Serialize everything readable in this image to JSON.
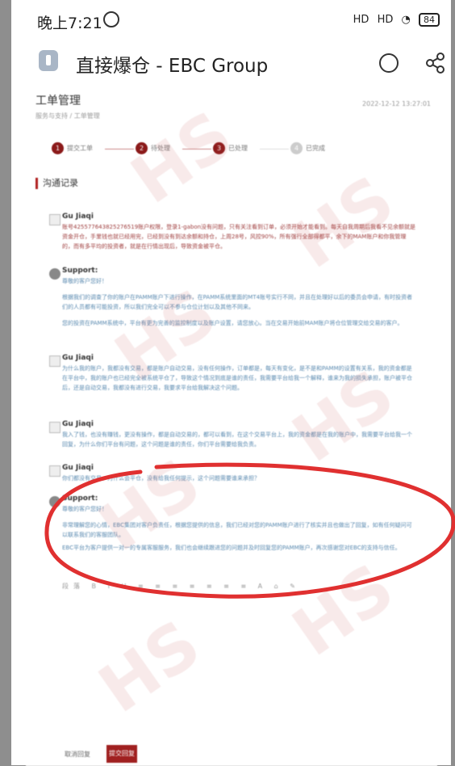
{
  "status_bar": {
    "time": "晚上7:21",
    "signal1": "HD",
    "signal2": "HD",
    "battery": "84"
  },
  "app_bar": {
    "title": "直接爆仓 - EBC Group"
  },
  "page": {
    "title": "工单管理",
    "breadcrumb": "服务与支持 / 工单管理",
    "meta": "2022-12-12 13:27:01"
  },
  "steps": [
    {
      "num": "1",
      "label": "提交工单"
    },
    {
      "num": "2",
      "label": "待处理"
    },
    {
      "num": "3",
      "label": "已处理"
    },
    {
      "num": "4",
      "label": "已完成"
    }
  ],
  "section_title": "沟通记录",
  "messages": [
    {
      "who": "Gu Jiaqi",
      "text": "账号425577643825276519账户权限，登录1-gabon没有问题，只有关注看到订单，必须开始才能看到。每天自我周期后我看不见余额就是资金开仓，手里钱也就已经用完，已经到没有到达余额和持仓，上周28号，风控90%，所有强行全部得都平，余下的MAM账户和你我管理的，而有多平均的投资者，就是在行情出现后，导致资金被平仓。"
    },
    {
      "who": "Support:",
      "text": "尊敬的客户您好！",
      "text2": "根据我们的调查了你的账户在PAMM账户下进行操作，在PAMM系统里面的MT4账号实行不同，并且在处理好以后的委员会申请，有时投资者们的人员都有可能投资，所以我们完全可以不参与仓位计划以及其他不同来。",
      "text3": "您的投资在PAMM系统中，平台有更为完善的监控制度以及账户设置，请您放心。当在交易开始前MAM账户将仓位管理交给交易的客户。"
    },
    {
      "who": "Gu Jiaqi",
      "text": "为什么我的账户，我都没有交易，都是账户自动交易，没有任何操作，订单都是，每天有变化，是不是和PAMM的设置有关系，我的资金都是在平台中，我的账户也已经完全被系统平仓了，导致这个情况到底是谁的责任，我需要平台给我一个解释，谁来为我的损失承担，账户被平仓后，还是自动交易，我都没有进行交易，我要求平台给我解决这个问题。"
    },
    {
      "who": "Gu Jiaqi",
      "text": "我入了钱，也没有赚钱，更没有操作，都是自动交易的，都可以看到，在这个交易平台上，我的资金都是在我的账户中，我需要平台给我一个回复，为什么你们平台有问题，这个问题是谁的责任，你们平台需要给我负责。"
    },
    {
      "who": "Gu Jiaqi",
      "text": "你们都没有交易，为什么会平仓，没有给我任何提示，这个问题需要谁来承担？"
    },
    {
      "who": "Support:",
      "text": "尊敬的客户您好！",
      "text2": "非常理解您的心情，EBC集团对客户负责任，根据您提供的信息，我们已经对您的PAMM账户进行了核实并且也做出了回复，如有任何疑问可以联系我们的客服团队。",
      "text3": "EBC平台为客户提供一对一的专属客服服务，我们也会继续跟进您的问题并及时回复您的PAMM账户，再次感谢您对EBC的支持与信任。"
    }
  ],
  "toolbar_label": "段落",
  "buttons": {
    "cancel": "取消回复",
    "submit": "提交回复"
  },
  "watermark": "HS"
}
